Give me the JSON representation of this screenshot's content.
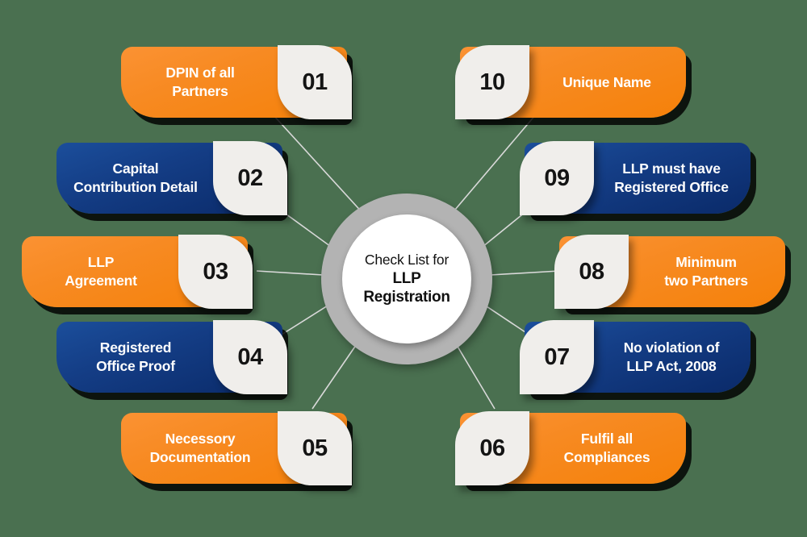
{
  "background_color": "#4a7050",
  "colors": {
    "orange": "#f78a22",
    "blue": "#143d85",
    "ring": "#b3b3b3",
    "number_panel": "#f0eeeb",
    "connector": "#d9d9d9"
  },
  "hub": {
    "line1": "Check List for",
    "line2": "LLP",
    "line3": "Registration"
  },
  "cards": [
    {
      "number": "01",
      "label_line1": "DPIN of all",
      "label_line2": "Partners",
      "color": "orange",
      "side": "left"
    },
    {
      "number": "02",
      "label_line1": "Capital",
      "label_line2": "Contribution Detail",
      "color": "blue",
      "side": "left"
    },
    {
      "number": "03",
      "label_line1": "LLP",
      "label_line2": "Agreement",
      "color": "orange",
      "side": "left"
    },
    {
      "number": "04",
      "label_line1": "Registered",
      "label_line2": "Office Proof",
      "color": "blue",
      "side": "left"
    },
    {
      "number": "05",
      "label_line1": "Necessory",
      "label_line2": "Documentation",
      "color": "orange",
      "side": "left"
    },
    {
      "number": "06",
      "label_line1": "Fulfil all",
      "label_line2": "Compliances",
      "color": "orange",
      "side": "right"
    },
    {
      "number": "07",
      "label_line1": "No violation of",
      "label_line2": "LLP Act, 2008",
      "color": "blue",
      "side": "right"
    },
    {
      "number": "08",
      "label_line1": "Minimum",
      "label_line2": "two Partners",
      "color": "orange",
      "side": "right"
    },
    {
      "number": "09",
      "label_line1": "LLP must have",
      "label_line2": "Registered Office",
      "color": "blue",
      "side": "right"
    },
    {
      "number": "10",
      "label_line1": "Unique Name",
      "label_line2": "",
      "color": "orange",
      "side": "right"
    }
  ]
}
